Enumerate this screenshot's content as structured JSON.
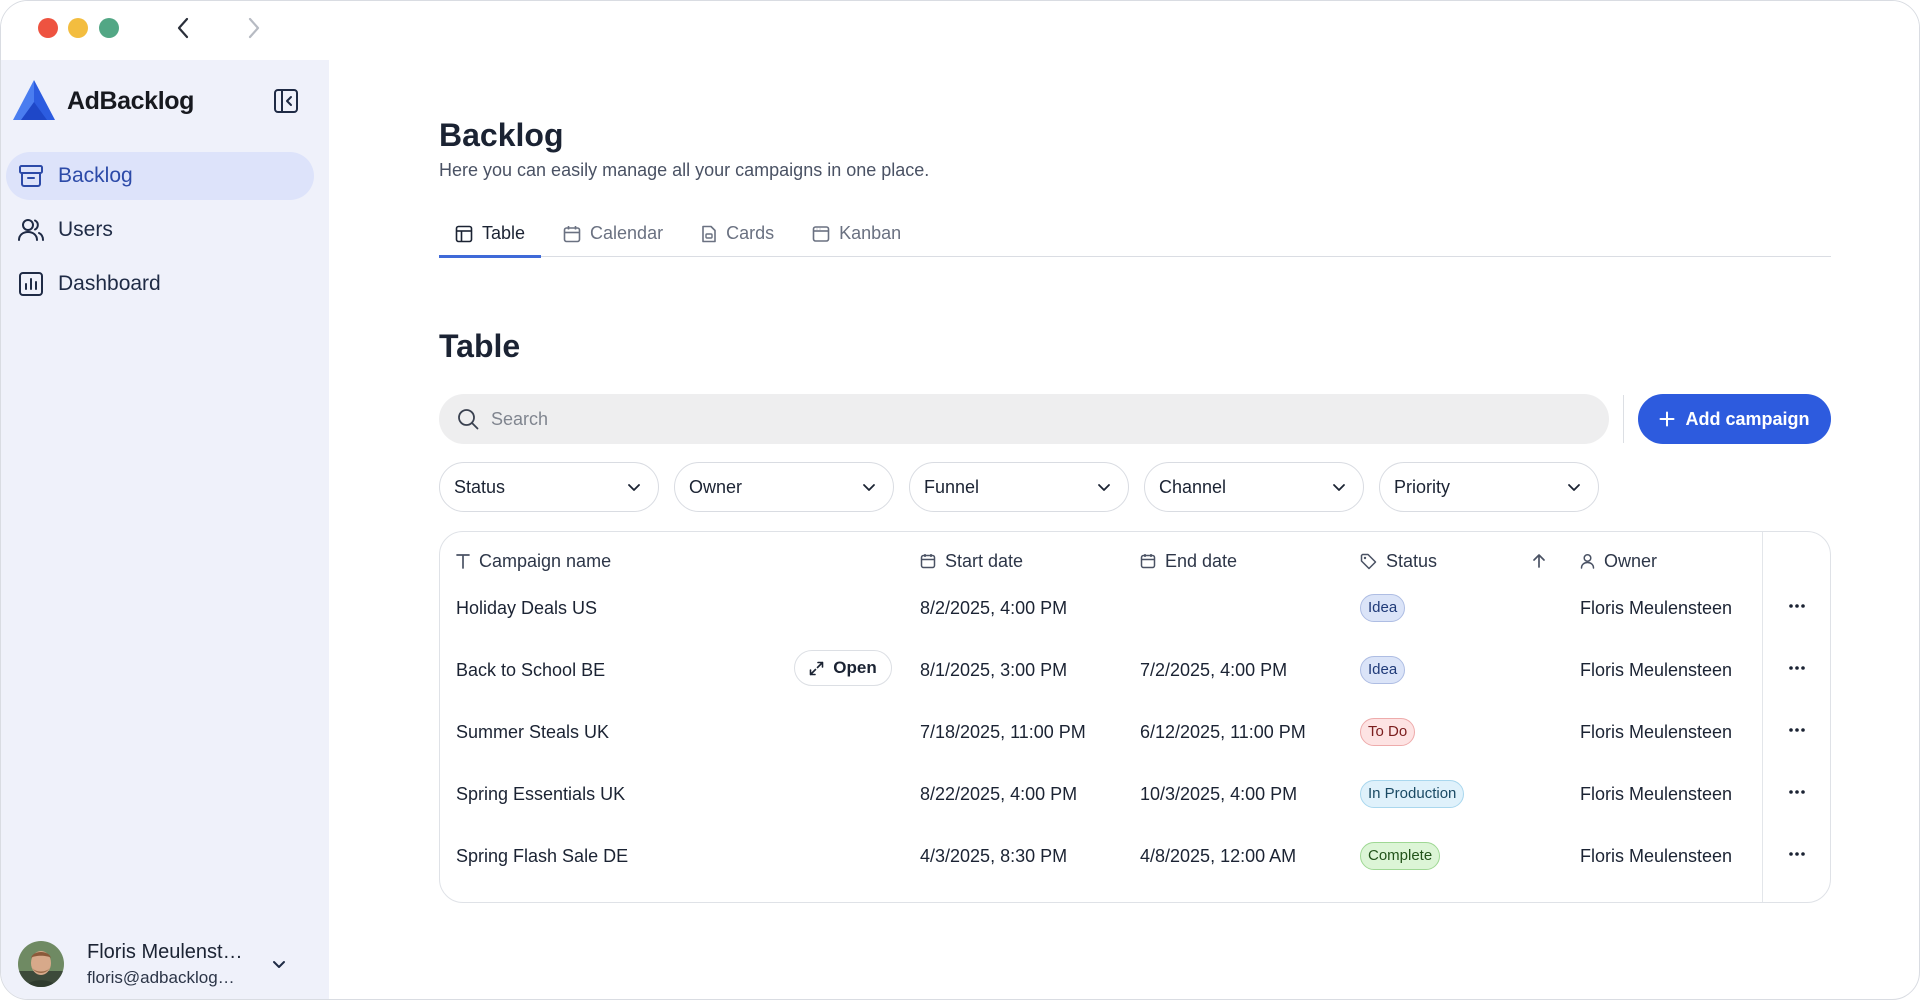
{
  "app": {
    "name": "AdBacklog",
    "accent": "#2d5bde"
  },
  "sidebar": {
    "items": [
      {
        "label": "Backlog",
        "icon": "archive-icon",
        "active": true
      },
      {
        "label": "Users",
        "icon": "users-icon",
        "active": false
      },
      {
        "label": "Dashboard",
        "icon": "chart-icon",
        "active": false
      }
    ],
    "user": {
      "name": "Floris Meulenst…",
      "email": "floris@adbacklog…"
    }
  },
  "page": {
    "title": "Backlog",
    "subtitle": "Here you can easily manage all your campaigns in one place."
  },
  "tabs": [
    {
      "label": "Table",
      "icon": "table-icon",
      "active": true
    },
    {
      "label": "Calendar",
      "icon": "calendar-icon",
      "active": false
    },
    {
      "label": "Cards",
      "icon": "cards-icon",
      "active": false
    },
    {
      "label": "Kanban",
      "icon": "kanban-icon",
      "active": false
    }
  ],
  "section": {
    "title": "Table"
  },
  "search": {
    "placeholder": "Search"
  },
  "toolbar": {
    "add_label": "Add campaign"
  },
  "filters": [
    "Status",
    "Owner",
    "Funnel",
    "Channel",
    "Priority"
  ],
  "table": {
    "columns": {
      "name": "Campaign name",
      "start": "Start date",
      "end": "End date",
      "status": "Status",
      "owner": "Owner"
    },
    "open_label": "Open",
    "rows": [
      {
        "name": "Holiday Deals US",
        "start": "8/2/2025, 4:00 PM",
        "end": "",
        "status": "Idea",
        "owner": "Floris Meulensteen"
      },
      {
        "name": "Back to School BE",
        "start": "8/1/2025, 3:00 PM",
        "end": "7/2/2025, 4:00 PM",
        "status": "Idea",
        "owner": "Floris Meulensteen"
      },
      {
        "name": "Summer Steals UK",
        "start": "7/18/2025, 11:00 PM",
        "end": "6/12/2025, 11:00 PM",
        "status": "To Do",
        "owner": "Floris Meulensteen"
      },
      {
        "name": "Spring Essentials UK",
        "start": "8/22/2025, 4:00 PM",
        "end": "10/3/2025, 4:00 PM",
        "status": "In Production",
        "owner": "Floris Meulensteen"
      },
      {
        "name": "Spring Flash Sale DE",
        "start": "4/3/2025, 8:30 PM",
        "end": "4/8/2025, 12:00 AM",
        "status": "Complete",
        "owner": "Floris Meulensteen"
      }
    ]
  },
  "status_colors": {
    "Idea": {
      "bg": "#dbe4f8",
      "border": "#aebde3",
      "text": "#1f3a78"
    },
    "To Do": {
      "bg": "#fde3e3",
      "border": "#eeabab",
      "text": "#7a1e1e"
    },
    "In Production": {
      "bg": "#dff1fb",
      "border": "#a9d7ee",
      "text": "#1a4a64"
    },
    "Complete": {
      "bg": "#dcf5d6",
      "border": "#9fd894",
      "text": "#22531a"
    }
  }
}
